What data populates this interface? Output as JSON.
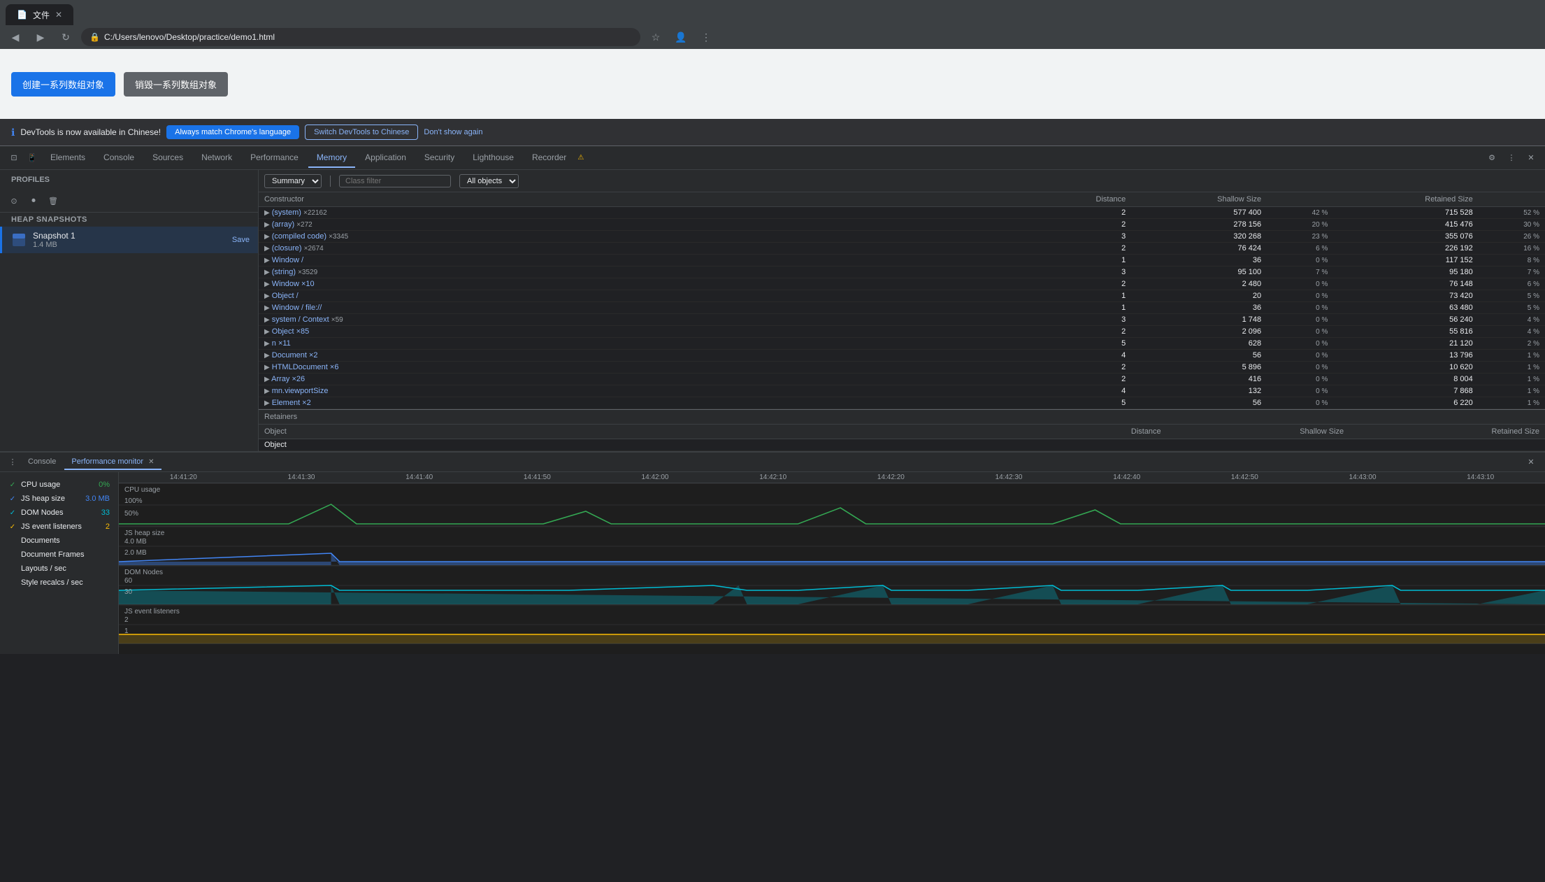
{
  "browser": {
    "tab_title": "文件",
    "address": "C:/Users/lenovo/Desktop/practice/demo1.html",
    "back_tooltip": "Back",
    "forward_tooltip": "Forward",
    "reload_tooltip": "Reload"
  },
  "page": {
    "btn1_label": "创建一系列数组对象",
    "btn2_label": "销毁一系列数组对象"
  },
  "notification": {
    "info_text": "DevTools is now available in Chinese!",
    "btn1_label": "Always match Chrome's language",
    "btn2_label": "Switch DevTools to Chinese",
    "link_label": "Don't show again"
  },
  "devtools": {
    "tabs": [
      "Elements",
      "Console",
      "Sources",
      "Network",
      "Performance",
      "Memory",
      "Application",
      "Security",
      "Lighthouse",
      "Recorder"
    ],
    "active_tab": "Memory"
  },
  "memory": {
    "sidebar": {
      "profiles_label": "Profiles",
      "heap_snapshots_label": "HEAP SNAPSHOTS",
      "snapshot_name": "Snapshot 1",
      "snapshot_size": "1.4 MB",
      "save_label": "Save"
    },
    "toolbar": {
      "summary_label": "Summary",
      "class_filter_label": "Class filter",
      "all_objects_label": "All objects"
    },
    "table": {
      "headers": [
        "Constructor",
        "Distance",
        "Shallow Size",
        "",
        "Retained Size",
        ""
      ],
      "rows": [
        {
          "name": "(system)",
          "count": "×22162",
          "distance": "2",
          "shallow": "577 400",
          "shallow_pct": "42 %",
          "retained": "715 528",
          "retained_pct": "52 %"
        },
        {
          "name": "(array)",
          "count": "×272",
          "distance": "2",
          "shallow": "278 156",
          "shallow_pct": "20 %",
          "retained": "415 476",
          "retained_pct": "30 %"
        },
        {
          "name": "(compiled code)",
          "count": "×3345",
          "distance": "3",
          "shallow": "320 268",
          "shallow_pct": "23 %",
          "retained": "355 076",
          "retained_pct": "26 %"
        },
        {
          "name": "(closure)",
          "count": "×2674",
          "distance": "2",
          "shallow": "76 424",
          "shallow_pct": "6 %",
          "retained": "226 192",
          "retained_pct": "16 %"
        },
        {
          "name": "Window /",
          "count": "",
          "distance": "1",
          "shallow": "36",
          "shallow_pct": "0 %",
          "retained": "117 152",
          "retained_pct": "8 %"
        },
        {
          "name": "(string)",
          "count": "×3529",
          "distance": "3",
          "shallow": "95 100",
          "shallow_pct": "7 %",
          "retained": "95 180",
          "retained_pct": "7 %"
        },
        {
          "name": "Window ×10",
          "count": "",
          "distance": "2",
          "shallow": "2 480",
          "shallow_pct": "0 %",
          "retained": "76 148",
          "retained_pct": "6 %"
        },
        {
          "name": "Object /",
          "count": "",
          "distance": "1",
          "shallow": "20",
          "shallow_pct": "0 %",
          "retained": "73 420",
          "retained_pct": "5 %"
        },
        {
          "name": "Window / file://",
          "count": "",
          "distance": "1",
          "shallow": "36",
          "shallow_pct": "0 %",
          "retained": "63 480",
          "retained_pct": "5 %"
        },
        {
          "name": "system / Context",
          "count": "×59",
          "distance": "3",
          "shallow": "1 748",
          "shallow_pct": "0 %",
          "retained": "56 240",
          "retained_pct": "4 %"
        },
        {
          "name": "Object ×85",
          "count": "",
          "distance": "2",
          "shallow": "2 096",
          "shallow_pct": "0 %",
          "retained": "55 816",
          "retained_pct": "4 %"
        },
        {
          "name": "n ×11",
          "count": "",
          "distance": "5",
          "shallow": "628",
          "shallow_pct": "0 %",
          "retained": "21 120",
          "retained_pct": "2 %"
        },
        {
          "name": "Document ×2",
          "count": "",
          "distance": "4",
          "shallow": "56",
          "shallow_pct": "0 %",
          "retained": "13 796",
          "retained_pct": "1 %"
        },
        {
          "name": "HTMLDocument ×6",
          "count": "",
          "distance": "2",
          "shallow": "5 896",
          "shallow_pct": "0 %",
          "retained": "10 620",
          "retained_pct": "1 %"
        },
        {
          "name": "Array ×26",
          "count": "",
          "distance": "2",
          "shallow": "416",
          "shallow_pct": "0 %",
          "retained": "8 004",
          "retained_pct": "1 %"
        },
        {
          "name": "mn.viewportSize",
          "count": "",
          "distance": "4",
          "shallow": "132",
          "shallow_pct": "0 %",
          "retained": "7 868",
          "retained_pct": "1 %"
        },
        {
          "name": "Element ×2",
          "count": "",
          "distance": "5",
          "shallow": "56",
          "shallow_pct": "0 %",
          "retained": "6 220",
          "retained_pct": "1 %"
        }
      ]
    },
    "retainers": {
      "title": "Retainers",
      "headers": [
        "Object",
        "Distance",
        "Shallow Size",
        "Retained Size"
      ],
      "object_label": "Object"
    }
  },
  "bottom_panel": {
    "tabs": [
      "Console",
      "Performance monitor"
    ],
    "active_tab": "Performance monitor"
  },
  "perf_monitor": {
    "metrics": [
      {
        "name": "CPU usage",
        "value": "0%",
        "color": "green",
        "checked": true
      },
      {
        "name": "JS heap size",
        "value": "3.0 MB",
        "color": "blue",
        "checked": true
      },
      {
        "name": "DOM Nodes",
        "value": "33",
        "color": "teal",
        "checked": true
      },
      {
        "name": "JS event listeners",
        "value": "2",
        "color": "yellow",
        "checked": true
      },
      {
        "name": "Documents",
        "value": "",
        "color": "",
        "checked": false
      },
      {
        "name": "Document Frames",
        "value": "",
        "color": "",
        "checked": false
      },
      {
        "name": "Layouts / sec",
        "value": "",
        "color": "",
        "checked": false
      },
      {
        "name": "Style recalcs / sec",
        "value": "",
        "color": "",
        "checked": false
      }
    ],
    "time_labels": [
      "14:41:20",
      "14:41:30",
      "14:41:40",
      "14:41:50",
      "14:42:00",
      "14:42:10",
      "14:42:20",
      "14:42:30",
      "14:42:40",
      "14:42:50",
      "14:43:00",
      "14:43:10"
    ],
    "cpu_label": "CPU usage",
    "cpu_max": "100%",
    "cpu_mid": "50%",
    "jsheap_label": "JS heap size",
    "jsheap_max": "4.0 MB",
    "jsheap_mid": "2.0 MB",
    "dom_label": "DOM Nodes",
    "dom_max": "60",
    "dom_mid": "30",
    "jsevent_label": "JS event listeners",
    "jsevent_max": "2",
    "jsevent_mid": "1"
  }
}
